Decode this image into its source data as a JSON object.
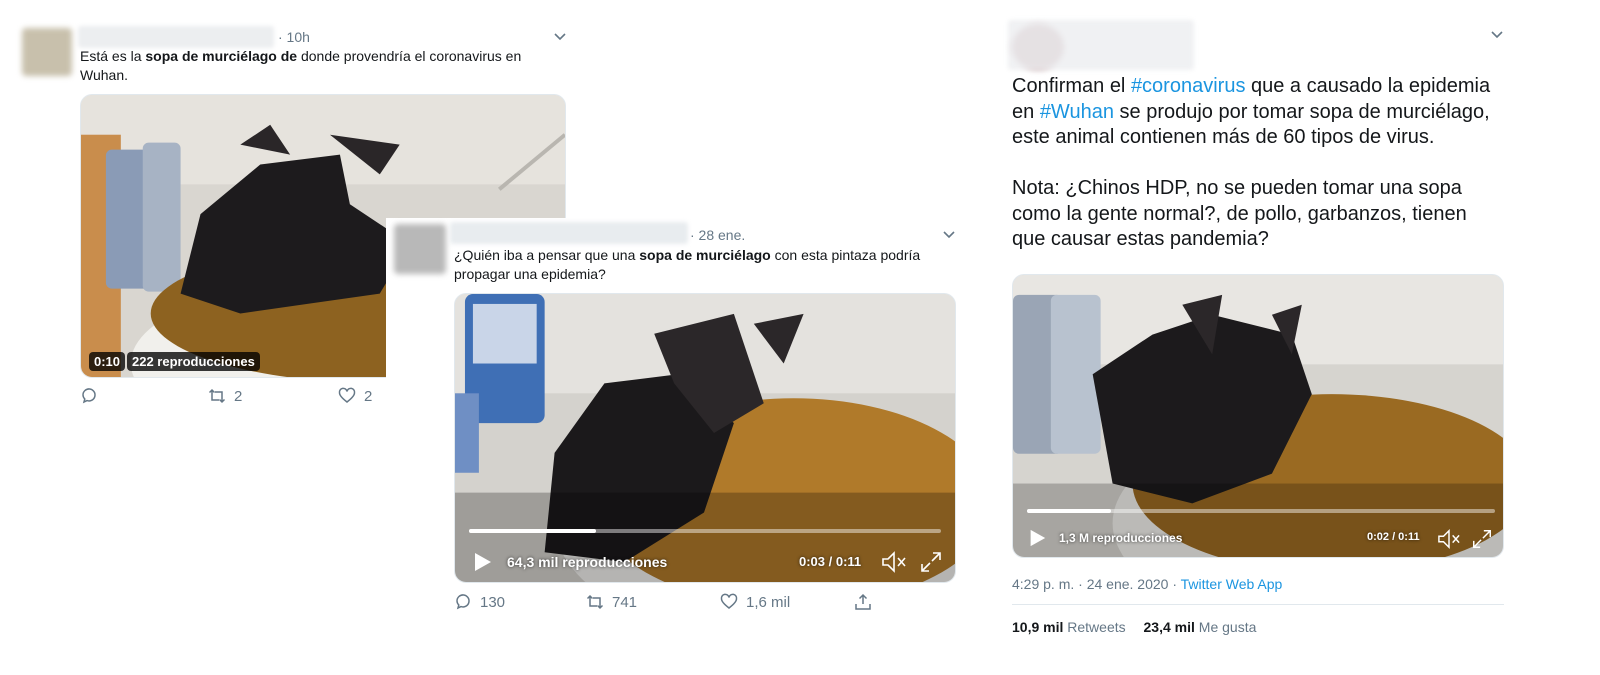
{
  "tweet1": {
    "time": "· 10h",
    "text_a": "Está es la ",
    "text_bold": "sopa de murciélago  de",
    "text_b": " donde provendría el coronavirus en Wuhan.",
    "duration": "0:10",
    "views": "222 reproducciones",
    "retweets": "2",
    "likes": "2"
  },
  "tweet2": {
    "time": "· 28 ene.",
    "text_a": "¿Quién iba a pensar que una ",
    "text_bold": "sopa de murciélago",
    "text_b": " con esta pintaza podría propagar una epidemia?",
    "views": "64,3 mil reproducciones",
    "timecode": "0:03 / 0:11",
    "progress": 0.27,
    "replies": "130",
    "retweets": "741",
    "likes": "1,6 mil"
  },
  "tweet3": {
    "p1_a": "Confirman el ",
    "hashtag1": "#coronavirus",
    "p1_b": " que a causado la epidemia en ",
    "hashtag2": "#Wuhan",
    "p1_c": " se produjo por tomar sopa de murciélago, este animal contienen más de 60 tipos de virus.",
    "p2": "Nota: ¿Chinos HDP, no se pueden tomar una sopa como la gente normal?, de pollo, garbanzos, tienen que causar estas pandemia?",
    "views": "1,3 M reproducciones",
    "timecode": "0:02 / 0:11",
    "progress": 0.18,
    "meta_date": "4:29 p. m. · 24 ene. 2020 · ",
    "meta_source": "Twitter Web App",
    "retweets_count": "10,9 mil",
    "retweets_label": "Retweets",
    "likes_count": "23,4 mil",
    "likes_label": "Me gusta"
  },
  "colors": {
    "link": "#1b95e0",
    "muted": "#657786",
    "soup": "#b07a2a"
  }
}
